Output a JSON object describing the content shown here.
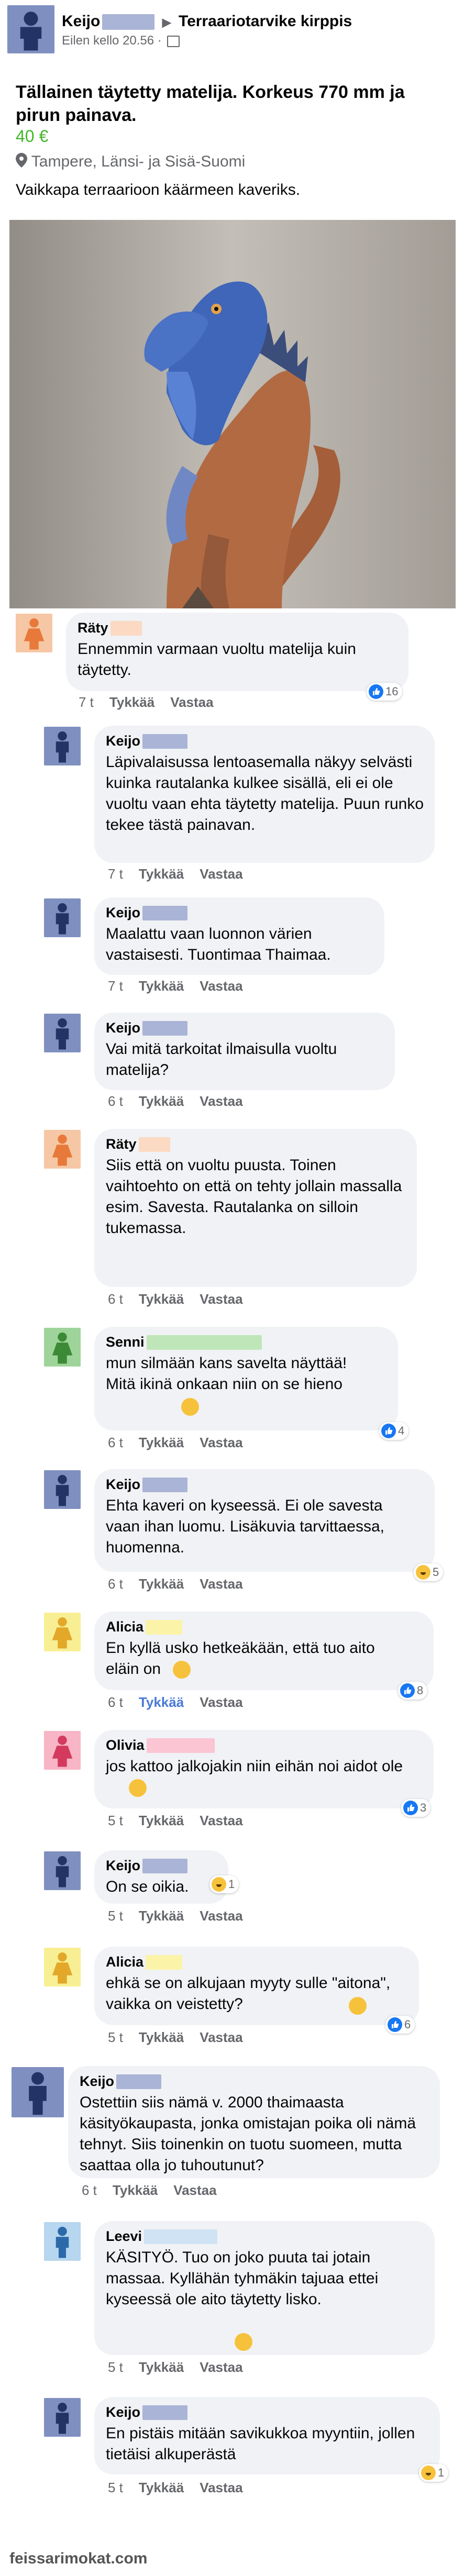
{
  "header": {
    "author": "Keijo",
    "group": "Terraariotarvike kirppis",
    "time": "Eilen kello 20.56 ·"
  },
  "post": {
    "title": "Tällainen täytetty matelija. Korkeus 770 mm ja pirun painava.",
    "price": "40 €",
    "location": "Tampere, Länsi- ja Sisä-Suomi",
    "description": "Vaikkapa terraarioon käärmeen kaveriks."
  },
  "actions": {
    "like": "Tykkää",
    "reply": "Vastaa"
  },
  "comments": [
    {
      "name": "Räty",
      "text": "Ennemmin varmaan vuoltu matelija kuin täytetty.",
      "time": "7 t",
      "reaction": "16"
    },
    {
      "name": "Keijo",
      "text": "Läpivalaisussa lentoasemalla näkyy selvästi kuinka rautalanka kulkee sisällä, eli ei ole vuoltu vaan ehta täytetty matelija. Puun runko tekee tästä painavan.",
      "time": "7 t"
    },
    {
      "name": "Keijo",
      "text": "Maalattu vaan luonnon värien vastaisesti. Tuontimaa Thaimaa.",
      "time": "7 t"
    },
    {
      "name": "Keijo",
      "text": "Vai mitä tarkoitat ilmaisulla vuoltu matelija?",
      "time": "6 t"
    },
    {
      "name": "Räty",
      "text": "Siis että on vuoltu puusta. Toinen vaihtoehto on että on tehty jollain massalla esim. Savesta. Rautalanka on silloin tukemassa.",
      "time": "6 t"
    },
    {
      "name": "Senni",
      "text": "mun silmään kans savelta näyttää! Mitä ikinä onkaan niin on se hieno",
      "time": "6 t",
      "reaction": "4"
    },
    {
      "name": "Keijo",
      "text": "Ehta kaveri on kyseessä. Ei ole savesta vaan ihan luomu. Lisäkuvia tarvittaessa, huomenna.",
      "time": "6 t",
      "reaction": "5"
    },
    {
      "name": "Alicia",
      "text": "En kyllä usko hetkeäkään, että tuo aito eläin on",
      "time": "6 t",
      "reaction": "8"
    },
    {
      "name": "Olivia",
      "text": "jos kattoo jalkojakin niin eihän noi aidot ole",
      "time": "5 t",
      "reaction": "3"
    },
    {
      "name": "Keijo",
      "text": "On se oikia.",
      "time": "5 t",
      "reaction": "1"
    },
    {
      "name": "Alicia",
      "text": "ehkä se on alkujaan myyty sulle \"aitona\", vaikka on veistetty?",
      "time": "5 t",
      "reaction": "6"
    },
    {
      "name": "Keijo",
      "text": "Ostettiin siis nämä v. 2000 thaimaasta käsityökaupasta, jonka omistajan poika oli nämä tehnyt. Siis toinenkin on tuotu suomeen, mutta saattaa olla jo tuhoutunut?",
      "time": "6 t"
    },
    {
      "name": "Leevi",
      "text": "KÄSITYÖ. Tuo on joko puuta tai jotain massaa. Kyllähän tyhmäkin tajuaa ettei kyseessä ole aito täytetty lisko.",
      "time": "5 t"
    },
    {
      "name": "Keijo",
      "text": "En pistäis mitään savikukkoa myyntiin, jollen tietäisi alkuperästä",
      "time": "5 t",
      "reaction": "1"
    }
  ],
  "watermark": "feissarimokat.com",
  "colors": {
    "price": "#42b72a",
    "link": "#4a7ad6",
    "bubble": "#f0f2f5",
    "like": "#1877f2",
    "haha": "#f7c23b"
  }
}
